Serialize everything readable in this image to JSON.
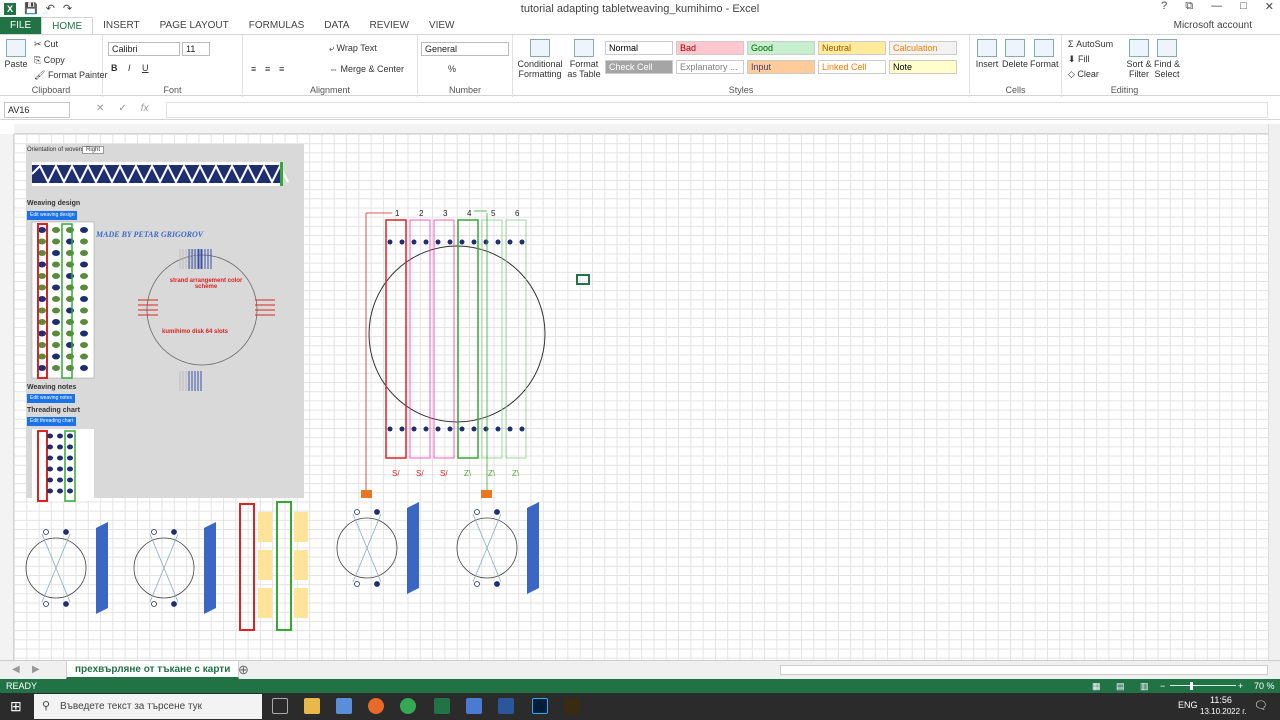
{
  "window": {
    "title": "tutorial adapting tabletweaving_kumihimo - Excel",
    "help": "?",
    "restore": "⧉",
    "minimize": "—",
    "maximize": "□",
    "close": "✕"
  },
  "tabs": [
    "FILE",
    "HOME",
    "INSERT",
    "PAGE LAYOUT",
    "FORMULAS",
    "DATA",
    "REVIEW",
    "VIEW"
  ],
  "account": "Microsoft account",
  "ribbon": {
    "clipboard": {
      "label": "Clipboard",
      "paste": "Paste",
      "cut": "Cut",
      "copy": "Copy",
      "format_painter": "Format Painter"
    },
    "font": {
      "label": "Font",
      "name": "Calibri",
      "size": "11",
      "bold": "B",
      "italic": "I",
      "underline": "U"
    },
    "alignment": {
      "label": "Alignment",
      "wrap": "Wrap Text",
      "merge": "Merge & Center"
    },
    "number": {
      "label": "Number",
      "format": "General",
      "percent": "%"
    },
    "styles": {
      "label": "Styles",
      "conditional": "Conditional Formatting",
      "format_table": "Format as Table",
      "cells": [
        {
          "name": "Normal",
          "bg": "#ffffff",
          "fg": "#000000"
        },
        {
          "name": "Bad",
          "bg": "#ffc7ce",
          "fg": "#9c0006"
        },
        {
          "name": "Good",
          "bg": "#c6efce",
          "fg": "#006100"
        },
        {
          "name": "Neutral",
          "bg": "#ffeb9c",
          "fg": "#9c5700"
        },
        {
          "name": "Calculation",
          "bg": "#f2f2f2",
          "fg": "#fa7d00"
        },
        {
          "name": "Check Cell",
          "bg": "#a5a5a5",
          "fg": "#ffffff"
        },
        {
          "name": "Explanatory ...",
          "bg": "#ffffff",
          "fg": "#7f7f7f"
        },
        {
          "name": "Input",
          "bg": "#ffcc99",
          "fg": "#3f3f76"
        },
        {
          "name": "Linked Cell",
          "bg": "#ffffff",
          "fg": "#fa7d00"
        },
        {
          "name": "Note",
          "bg": "#ffffcc",
          "fg": "#000000"
        }
      ]
    },
    "cells": {
      "label": "Cells",
      "insert": "Insert",
      "delete": "Delete",
      "format": "Format"
    },
    "editing": {
      "label": "Editing",
      "autosum": "AutoSum",
      "fill": "Fill",
      "clear": "Clear",
      "sort": "Sort & Filter",
      "find": "Find & Select"
    }
  },
  "formula_bar": {
    "name_box": "AV16",
    "cancel": "✕",
    "enter": "✓",
    "fx": "fx",
    "value": ""
  },
  "sheet": {
    "orientation_label": "Orientation of woven bands",
    "orientation_value": "Right",
    "weaving_design": "Weaving design",
    "edit_weaving_design": "Edit weaving design",
    "made_by": "MADE BY PETAR GRIGOROV",
    "strand_arrangement": "strand arrangement color scheme",
    "disk_label": "kumihimo disk 64 slots",
    "weaving_notes": "Weaving notes",
    "edit_weaving_notes": "Edit weaving notes",
    "threading_chart": "Threading chart",
    "edit_threading_chart": "Edit threading chart",
    "columns": [
      "1",
      "2",
      "3",
      "4",
      "5",
      "6"
    ],
    "twist": [
      "S/",
      "S/",
      "S/",
      "Z\\",
      "Z\\",
      "Z\\"
    ]
  },
  "sheet_tab": "прехвърляне от тъкане с карти",
  "status": {
    "ready": "READY",
    "zoom": "70 %"
  },
  "taskbar": {
    "search_placeholder": "Въведете текст за търсене тук",
    "lang": "ENG",
    "time": "11:56",
    "date": "13.10.2022 г."
  }
}
